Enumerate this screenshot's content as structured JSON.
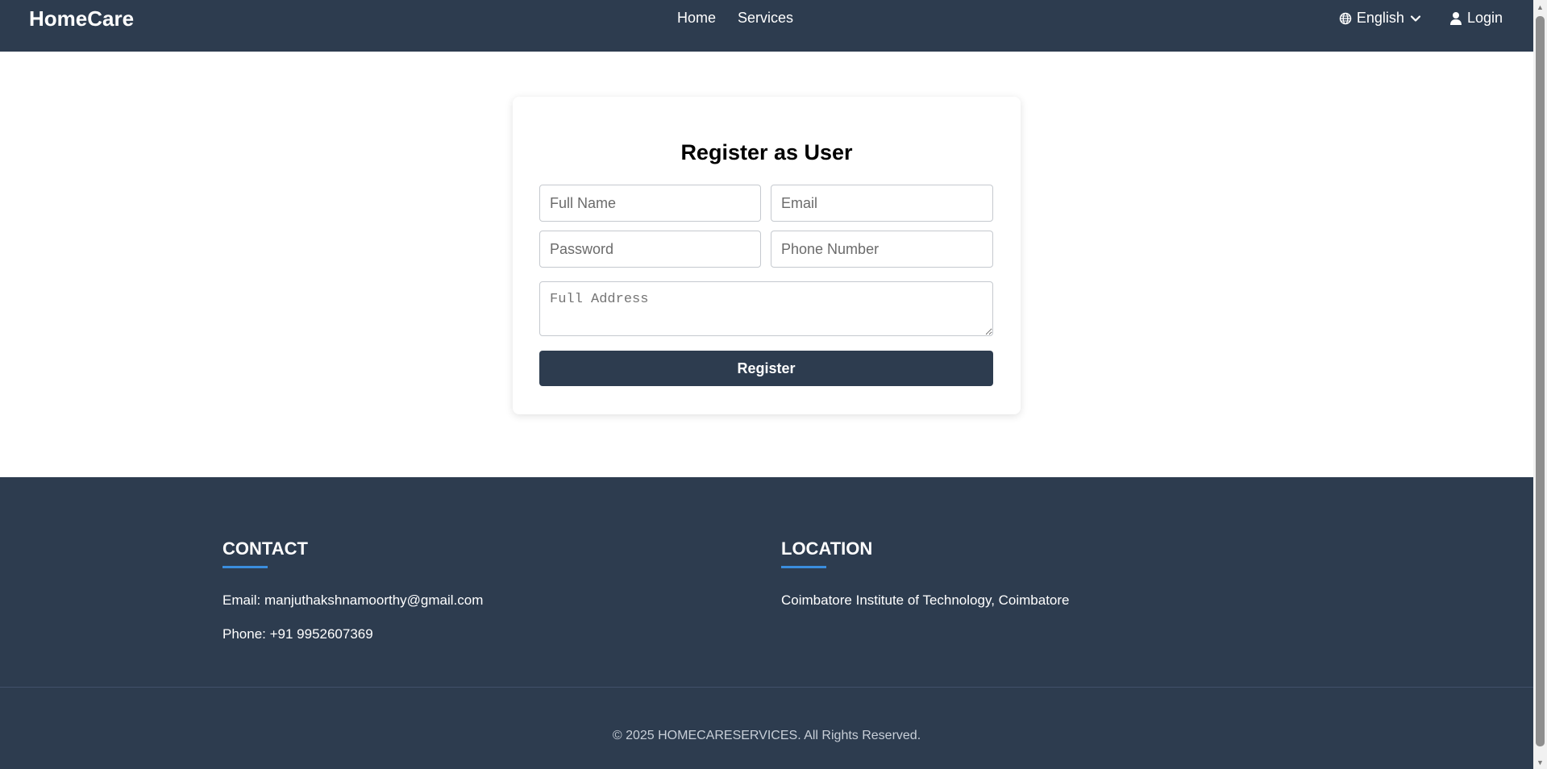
{
  "navbar": {
    "brand": "HomeCare",
    "links": [
      "Home",
      "Services"
    ],
    "language": "English",
    "login": "Login"
  },
  "form": {
    "title": "Register as User",
    "full_name_placeholder": "Full Name",
    "email_placeholder": "Email",
    "password_placeholder": "Password",
    "phone_placeholder": "Phone Number",
    "address_placeholder": "Full Address",
    "register_label": "Register"
  },
  "footer": {
    "contact_title": "CONTACT",
    "contact_email": "Email: manjuthakshnamoorthy@gmail.com",
    "contact_phone": "Phone: +91 9952607369",
    "location_title": "LOCATION",
    "location_text": "Coimbatore Institute of Technology, Coimbatore",
    "copyright": "© 2025 HOMECARESERVICES. All Rights Reserved."
  },
  "colors": {
    "primary": "#2d3c4f",
    "accent": "#3a8dde"
  },
  "icons": {
    "globe": "globe-icon",
    "chevron": "chevron-down-icon",
    "user": "user-icon"
  }
}
